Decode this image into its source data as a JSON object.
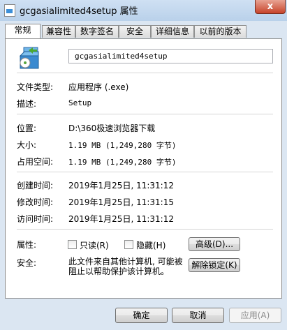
{
  "window": {
    "title": "gcgasialimited4setup 属性",
    "close_glyph": "x"
  },
  "tabs": [
    {
      "label": "常规",
      "active": true
    },
    {
      "label": "兼容性"
    },
    {
      "label": "数字签名"
    },
    {
      "label": "安全"
    },
    {
      "label": "详细信息"
    },
    {
      "label": "以前的版本"
    }
  ],
  "general": {
    "file_name": "gcgasialimited4setup",
    "icon": "installer-package-icon",
    "rows": {
      "type_label": "文件类型:",
      "type_value": "应用程序 (.exe)",
      "desc_label": "描述:",
      "desc_value": "Setup",
      "location_label": "位置:",
      "location_value": "D:\\360极速浏览器下载",
      "size_label": "大小:",
      "size_value": "1.19 MB (1,249,280 字节)",
      "disk_size_label": "占用空间:",
      "disk_size_value": "1.19 MB (1,249,280 字节)",
      "created_label": "创建时间:",
      "created_value": "2019年1月25日, 11:31:12",
      "modified_label": "修改时间:",
      "modified_value": "2019年1月25日, 11:31:15",
      "accessed_label": "访问时间:",
      "accessed_value": "2019年1月25日, 11:31:12",
      "attributes_label": "属性:",
      "readonly_label": "只读(R)",
      "readonly_checked": false,
      "hidden_label": "隐藏(H)",
      "hidden_checked": false,
      "advanced_button": "高级(D)...",
      "security_label": "安全:",
      "security_text": "此文件来自其他计算机, 可能被阻止以帮助保护该计算机。",
      "unblock_button": "解除锁定(K)"
    }
  },
  "footer": {
    "ok": "确定",
    "cancel": "取消",
    "apply": "应用(A)"
  }
}
